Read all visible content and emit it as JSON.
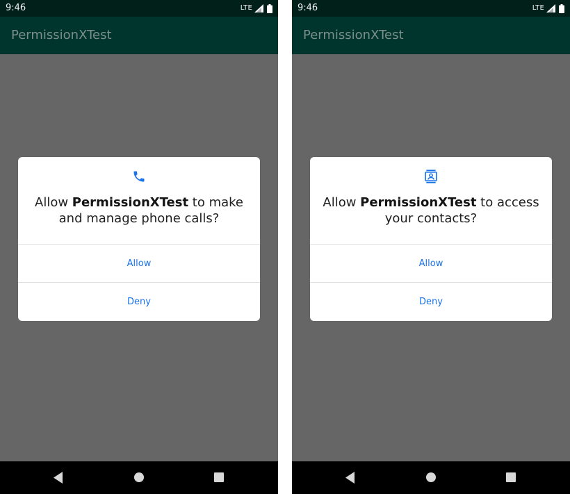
{
  "screens": [
    {
      "status_bar": {
        "time": "9:46",
        "network": "LTE"
      },
      "app_bar": {
        "title": "PermissionXTest"
      },
      "dialog": {
        "icon": "phone-icon",
        "message_prefix": "Allow ",
        "app_name": "PermissionXTest",
        "message_suffix": " to make and manage phone calls?",
        "allow_label": "Allow",
        "deny_label": "Deny"
      }
    },
    {
      "status_bar": {
        "time": "9:46",
        "network": "LTE"
      },
      "app_bar": {
        "title": "PermissionXTest"
      },
      "dialog": {
        "icon": "contacts-icon",
        "message_prefix": "Allow ",
        "app_name": "PermissionXTest",
        "message_suffix": " to access your contacts?",
        "allow_label": "Allow",
        "deny_label": "Deny"
      }
    }
  ],
  "colors": {
    "status_bar_bg": "#002019",
    "app_bar_bg": "#00352d",
    "scrim": "#666666",
    "accent_button": "#1a73e8",
    "nav_bar_bg": "#000000"
  }
}
